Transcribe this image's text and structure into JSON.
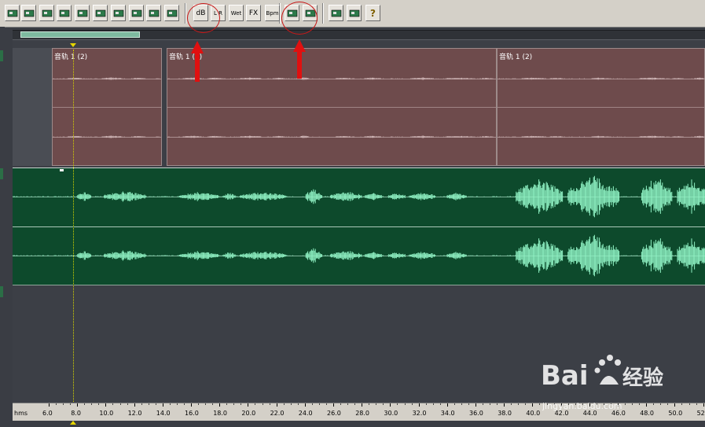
{
  "toolbar": {
    "buttons": [
      {
        "icon": "mixdown-icon",
        "label": ""
      },
      {
        "icon": "wrench-icon",
        "label": ""
      },
      {
        "icon": "track-lock-icon",
        "label": ""
      },
      {
        "icon": "clip-lock-icon",
        "label": ""
      },
      {
        "icon": "align-icon",
        "label": ""
      },
      {
        "icon": "snap-icon",
        "label": ""
      },
      {
        "icon": "loop-icon",
        "label": ""
      },
      {
        "icon": "zoom-sparkle-icon",
        "label": ""
      },
      {
        "icon": "level-icon",
        "label": ""
      },
      {
        "icon": "download-icon",
        "label": ""
      },
      {
        "icon": "volume-envelope-icon",
        "label": "dB"
      },
      {
        "icon": "pan-envelope-icon",
        "label": "L R"
      },
      {
        "icon": "wet-envelope-icon",
        "label": "Wet"
      },
      {
        "icon": "fx-envelope-icon",
        "label": "FX"
      },
      {
        "icon": "bpm-envelope-icon",
        "label": "Bpm"
      },
      {
        "icon": "edit-envelope-icon",
        "label": ""
      },
      {
        "icon": "spline-icon",
        "label": ""
      },
      {
        "icon": "settings-icon",
        "label": ""
      },
      {
        "icon": "cd-icon",
        "label": ""
      },
      {
        "icon": "help-icon",
        "label": "?"
      }
    ]
  },
  "clips": [
    {
      "label": "音轨 1 (2)"
    },
    {
      "label": "音轨 1 (2)"
    },
    {
      "label": "音轨 1 (2)"
    }
  ],
  "ruler": {
    "unit_label": "hms",
    "ticks": [
      "6.0",
      "8.0",
      "10.0",
      "12.0",
      "14.0",
      "16.0",
      "18.0",
      "20.0",
      "22.0",
      "24.0",
      "26.0",
      "28.0",
      "30.0",
      "32.0",
      "34.0",
      "36.0",
      "38.0",
      "40.0",
      "42.0",
      "44.0",
      "46.0",
      "48.0",
      "50.0",
      "52.0"
    ]
  },
  "colors": {
    "clip_fill": "#6e4b4c",
    "green_track": "#0d4a2c",
    "waveform_green": "#8ff2c4",
    "annotation_red": "#e01010"
  },
  "watermark": {
    "text": "jingyan.baidu.com",
    "logo": "Baidu经验"
  }
}
